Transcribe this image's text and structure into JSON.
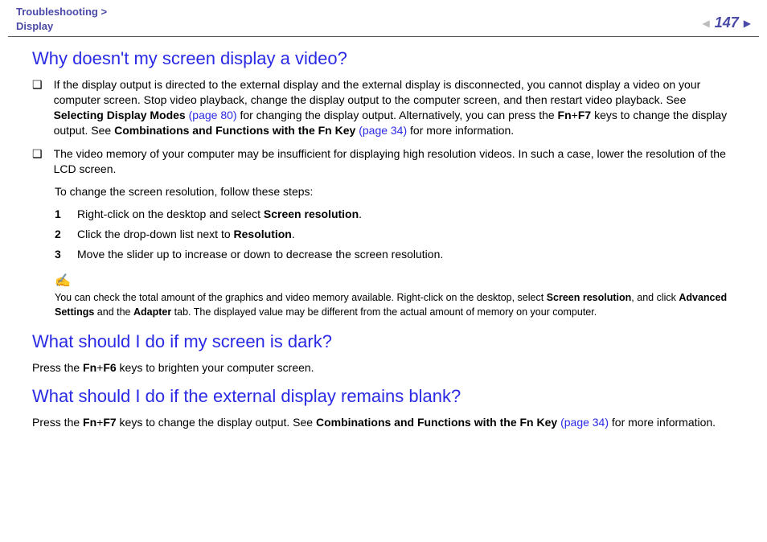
{
  "header": {
    "breadcrumb_section": "Troubleshooting",
    "breadcrumb_sep": ">",
    "breadcrumb_sub": "Display",
    "page_number": "147"
  },
  "sec1": {
    "heading": "Why doesn't my screen display a video?",
    "b1": {
      "t1": "If the display output is directed to the external display and the external display is disconnected, you cannot display a video on your computer screen. Stop video playback, change the display output to the computer screen, and then restart video playback. See ",
      "b1": "Selecting Display Modes ",
      "l1": "(page 80)",
      "t2": " for changing the display output. Alternatively, you can press the ",
      "b2": "Fn",
      "t3": "+",
      "b3": "F7",
      "t4": " keys to change the display output. See ",
      "b4": "Combinations and Functions with the Fn Key ",
      "l2": "(page 34)",
      "t5": " for more information."
    },
    "b2": {
      "t1": "The video memory of your computer may be insufficient for displaying high resolution videos. In such a case, lower the resolution of the LCD screen."
    },
    "steps_intro": "To change the screen resolution, follow these steps:",
    "step1": {
      "t1": "Right-click on the desktop and select ",
      "b1": "Screen resolution",
      "t2": "."
    },
    "step2": {
      "t1": "Click the drop-down list next to ",
      "b1": "Resolution",
      "t2": "."
    },
    "step3": {
      "t1": "Move the slider up to increase or down to decrease the screen resolution."
    },
    "note": {
      "t1": "You can check the total amount of the graphics and video memory available. Right-click on the desktop, select ",
      "b1": "Screen resolution",
      "t2": ", and click ",
      "b2": "Advanced Settings",
      "t3": " and the ",
      "b3": "Adapter",
      "t4": " tab. The displayed value may be different from the actual amount of memory on your computer."
    }
  },
  "sec2": {
    "heading": "What should I do if my screen is dark?",
    "p": {
      "t1": "Press the ",
      "b1": "Fn",
      "t2": "+",
      "b2": "F6",
      "t3": " keys to brighten your computer screen."
    }
  },
  "sec3": {
    "heading": "What should I do if the external display remains blank?",
    "p": {
      "t1": "Press the ",
      "b1": "Fn",
      "t2": "+",
      "b2": "F7",
      "t3": " keys to change the display output. See ",
      "b3": "Combinations and Functions with the Fn Key ",
      "l1": "(page 34)",
      "t4": " for more information."
    }
  }
}
